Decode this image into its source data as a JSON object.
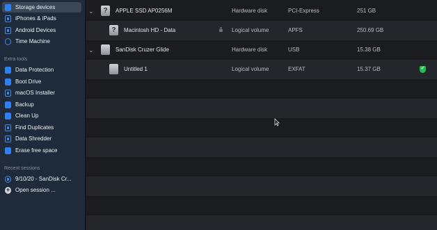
{
  "sidebar": {
    "items": [
      {
        "label": "Storage devices",
        "icon": "storage-icon"
      },
      {
        "label": "iPhones & iPads",
        "icon": "iphone-icon"
      },
      {
        "label": "Android Devices",
        "icon": "android-icon"
      },
      {
        "label": "Time Machine",
        "icon": "time-machine-icon"
      }
    ],
    "extra_tools_title": "Extra tools",
    "tools": [
      {
        "label": "Data Protection",
        "icon": "shield-icon"
      },
      {
        "label": "Boot Drive",
        "icon": "boot-drive-icon"
      },
      {
        "label": "macOS Installer",
        "icon": "macos-installer-icon"
      },
      {
        "label": "Backup",
        "icon": "backup-icon"
      },
      {
        "label": "Clean Up",
        "icon": "clean-up-icon"
      },
      {
        "label": "Find Duplicates",
        "icon": "duplicates-icon"
      },
      {
        "label": "Data Shredder",
        "icon": "shredder-icon"
      },
      {
        "label": "Erase free space",
        "icon": "erase-icon"
      }
    ],
    "recent_title": "Recent sessions",
    "sessions": [
      {
        "label": "9/10/20 - SanDisk Cr...",
        "icon": "session-icon"
      },
      {
        "label": "Open session ...",
        "icon": "add-icon"
      }
    ]
  },
  "devices": [
    {
      "name": "APPLE SSD AP0256M",
      "type": "Hardware disk",
      "format": "PCI-Express",
      "size": "251 GB"
    },
    {
      "name": "Macintosh HD - Data",
      "type": "Logical volume",
      "format": "APFS",
      "size": "250.69 GB"
    },
    {
      "name": "SanDisk Cruzer Glide",
      "type": "Hardware disk",
      "format": "USB",
      "size": "15.38 GB"
    },
    {
      "name": "Untitled 1",
      "type": "Logical volume",
      "format": "EXFAT",
      "size": "15.37 GB"
    }
  ],
  "colors": {
    "accent": "#2c7ff1",
    "protected": "#1fbf4a"
  }
}
